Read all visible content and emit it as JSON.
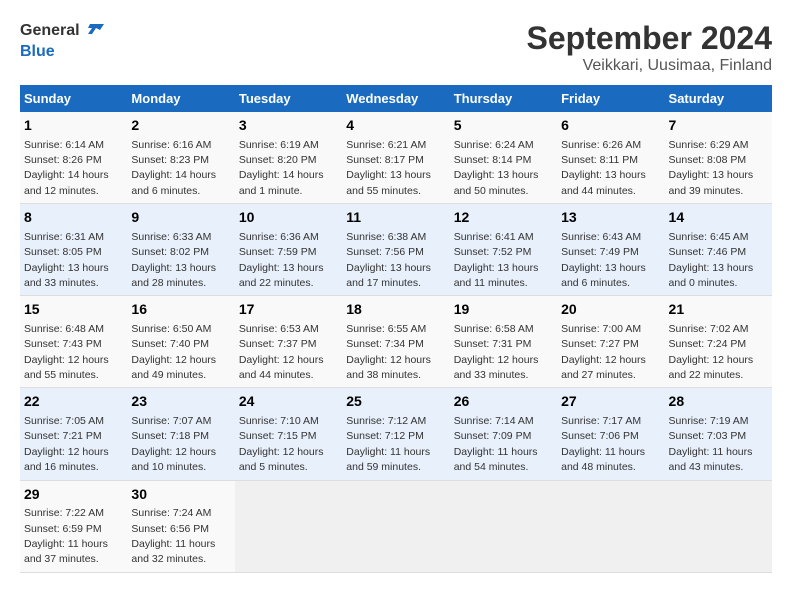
{
  "logo": {
    "text_general": "General",
    "text_blue": "Blue"
  },
  "title": "September 2024",
  "subtitle": "Veikkari, Uusimaa, Finland",
  "days_of_week": [
    "Sunday",
    "Monday",
    "Tuesday",
    "Wednesday",
    "Thursday",
    "Friday",
    "Saturday"
  ],
  "weeks": [
    [
      {
        "day": "1",
        "sunrise": "Sunrise: 6:14 AM",
        "sunset": "Sunset: 8:26 PM",
        "daylight": "Daylight: 14 hours and 12 minutes."
      },
      {
        "day": "2",
        "sunrise": "Sunrise: 6:16 AM",
        "sunset": "Sunset: 8:23 PM",
        "daylight": "Daylight: 14 hours and 6 minutes."
      },
      {
        "day": "3",
        "sunrise": "Sunrise: 6:19 AM",
        "sunset": "Sunset: 8:20 PM",
        "daylight": "Daylight: 14 hours and 1 minute."
      },
      {
        "day": "4",
        "sunrise": "Sunrise: 6:21 AM",
        "sunset": "Sunset: 8:17 PM",
        "daylight": "Daylight: 13 hours and 55 minutes."
      },
      {
        "day": "5",
        "sunrise": "Sunrise: 6:24 AM",
        "sunset": "Sunset: 8:14 PM",
        "daylight": "Daylight: 13 hours and 50 minutes."
      },
      {
        "day": "6",
        "sunrise": "Sunrise: 6:26 AM",
        "sunset": "Sunset: 8:11 PM",
        "daylight": "Daylight: 13 hours and 44 minutes."
      },
      {
        "day": "7",
        "sunrise": "Sunrise: 6:29 AM",
        "sunset": "Sunset: 8:08 PM",
        "daylight": "Daylight: 13 hours and 39 minutes."
      }
    ],
    [
      {
        "day": "8",
        "sunrise": "Sunrise: 6:31 AM",
        "sunset": "Sunset: 8:05 PM",
        "daylight": "Daylight: 13 hours and 33 minutes."
      },
      {
        "day": "9",
        "sunrise": "Sunrise: 6:33 AM",
        "sunset": "Sunset: 8:02 PM",
        "daylight": "Daylight: 13 hours and 28 minutes."
      },
      {
        "day": "10",
        "sunrise": "Sunrise: 6:36 AM",
        "sunset": "Sunset: 7:59 PM",
        "daylight": "Daylight: 13 hours and 22 minutes."
      },
      {
        "day": "11",
        "sunrise": "Sunrise: 6:38 AM",
        "sunset": "Sunset: 7:56 PM",
        "daylight": "Daylight: 13 hours and 17 minutes."
      },
      {
        "day": "12",
        "sunrise": "Sunrise: 6:41 AM",
        "sunset": "Sunset: 7:52 PM",
        "daylight": "Daylight: 13 hours and 11 minutes."
      },
      {
        "day": "13",
        "sunrise": "Sunrise: 6:43 AM",
        "sunset": "Sunset: 7:49 PM",
        "daylight": "Daylight: 13 hours and 6 minutes."
      },
      {
        "day": "14",
        "sunrise": "Sunrise: 6:45 AM",
        "sunset": "Sunset: 7:46 PM",
        "daylight": "Daylight: 13 hours and 0 minutes."
      }
    ],
    [
      {
        "day": "15",
        "sunrise": "Sunrise: 6:48 AM",
        "sunset": "Sunset: 7:43 PM",
        "daylight": "Daylight: 12 hours and 55 minutes."
      },
      {
        "day": "16",
        "sunrise": "Sunrise: 6:50 AM",
        "sunset": "Sunset: 7:40 PM",
        "daylight": "Daylight: 12 hours and 49 minutes."
      },
      {
        "day": "17",
        "sunrise": "Sunrise: 6:53 AM",
        "sunset": "Sunset: 7:37 PM",
        "daylight": "Daylight: 12 hours and 44 minutes."
      },
      {
        "day": "18",
        "sunrise": "Sunrise: 6:55 AM",
        "sunset": "Sunset: 7:34 PM",
        "daylight": "Daylight: 12 hours and 38 minutes."
      },
      {
        "day": "19",
        "sunrise": "Sunrise: 6:58 AM",
        "sunset": "Sunset: 7:31 PM",
        "daylight": "Daylight: 12 hours and 33 minutes."
      },
      {
        "day": "20",
        "sunrise": "Sunrise: 7:00 AM",
        "sunset": "Sunset: 7:27 PM",
        "daylight": "Daylight: 12 hours and 27 minutes."
      },
      {
        "day": "21",
        "sunrise": "Sunrise: 7:02 AM",
        "sunset": "Sunset: 7:24 PM",
        "daylight": "Daylight: 12 hours and 22 minutes."
      }
    ],
    [
      {
        "day": "22",
        "sunrise": "Sunrise: 7:05 AM",
        "sunset": "Sunset: 7:21 PM",
        "daylight": "Daylight: 12 hours and 16 minutes."
      },
      {
        "day": "23",
        "sunrise": "Sunrise: 7:07 AM",
        "sunset": "Sunset: 7:18 PM",
        "daylight": "Daylight: 12 hours and 10 minutes."
      },
      {
        "day": "24",
        "sunrise": "Sunrise: 7:10 AM",
        "sunset": "Sunset: 7:15 PM",
        "daylight": "Daylight: 12 hours and 5 minutes."
      },
      {
        "day": "25",
        "sunrise": "Sunrise: 7:12 AM",
        "sunset": "Sunset: 7:12 PM",
        "daylight": "Daylight: 11 hours and 59 minutes."
      },
      {
        "day": "26",
        "sunrise": "Sunrise: 7:14 AM",
        "sunset": "Sunset: 7:09 PM",
        "daylight": "Daylight: 11 hours and 54 minutes."
      },
      {
        "day": "27",
        "sunrise": "Sunrise: 7:17 AM",
        "sunset": "Sunset: 7:06 PM",
        "daylight": "Daylight: 11 hours and 48 minutes."
      },
      {
        "day": "28",
        "sunrise": "Sunrise: 7:19 AM",
        "sunset": "Sunset: 7:03 PM",
        "daylight": "Daylight: 11 hours and 43 minutes."
      }
    ],
    [
      {
        "day": "29",
        "sunrise": "Sunrise: 7:22 AM",
        "sunset": "Sunset: 6:59 PM",
        "daylight": "Daylight: 11 hours and 37 minutes."
      },
      {
        "day": "30",
        "sunrise": "Sunrise: 7:24 AM",
        "sunset": "Sunset: 6:56 PM",
        "daylight": "Daylight: 11 hours and 32 minutes."
      },
      null,
      null,
      null,
      null,
      null
    ]
  ]
}
